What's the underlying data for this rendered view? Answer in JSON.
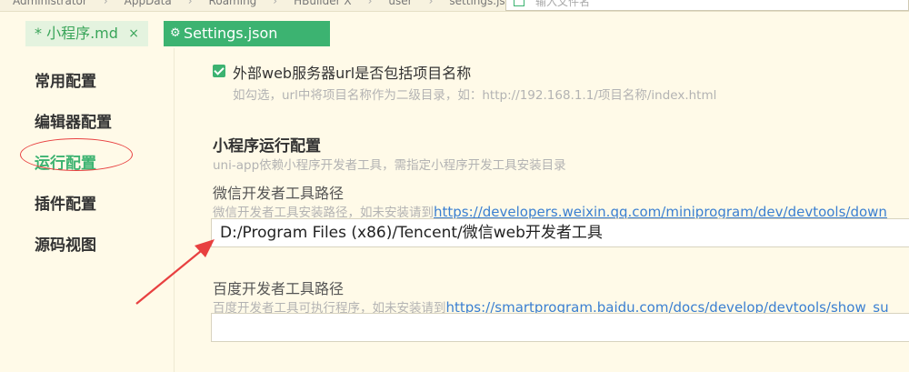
{
  "breadcrumb": [
    "Administrator",
    "AppData",
    "Roaming",
    "HBuilder X",
    "user",
    "settings.json"
  ],
  "search": {
    "placeholder": "输入文件名"
  },
  "tabs": [
    {
      "label": "* 小程序.md",
      "close": "×"
    },
    {
      "label": "Settings.json"
    }
  ],
  "sidebar": {
    "items": [
      {
        "label": "常用配置"
      },
      {
        "label": "编辑器配置"
      },
      {
        "label": "运行配置"
      },
      {
        "label": "插件配置"
      },
      {
        "label": "源码视图"
      }
    ]
  },
  "main": {
    "include_project_name": {
      "label": "外部web服务器url是否包括项目名称",
      "checked": true,
      "hint": "如勾选，url中将项目名称作为二级目录，如：http://192.168.1.1/项目名称/index.html"
    },
    "miniprogram_section": {
      "title": "小程序运行配置",
      "hint": "uni-app依赖小程序开发者工具，需指定小程序开发工具安装目录"
    },
    "wechat_tool": {
      "label": "微信开发者工具路径",
      "hint_prefix": "微信开发者工具安装路径，如未安装请到",
      "link": "https://developers.weixin.qq.com/miniprogram/dev/devtools/down",
      "value": "D:/Program Files (x86)/Tencent/微信web开发者工具"
    },
    "baidu_tool": {
      "label": "百度开发者工具路径",
      "hint_prefix": "百度开发者工具可执行程序，如未安装请到",
      "link": "https://smartprogram.baidu.com/docs/develop/devtools/show_su",
      "value": ""
    }
  },
  "colors": {
    "accent": "#3cb371",
    "background": "#fffae8",
    "annotation": "#e84040",
    "link": "#3a7fd1"
  },
  "icons": [
    "gear-icon",
    "close-icon",
    "checkbox-checked-icon",
    "search-icon"
  ]
}
